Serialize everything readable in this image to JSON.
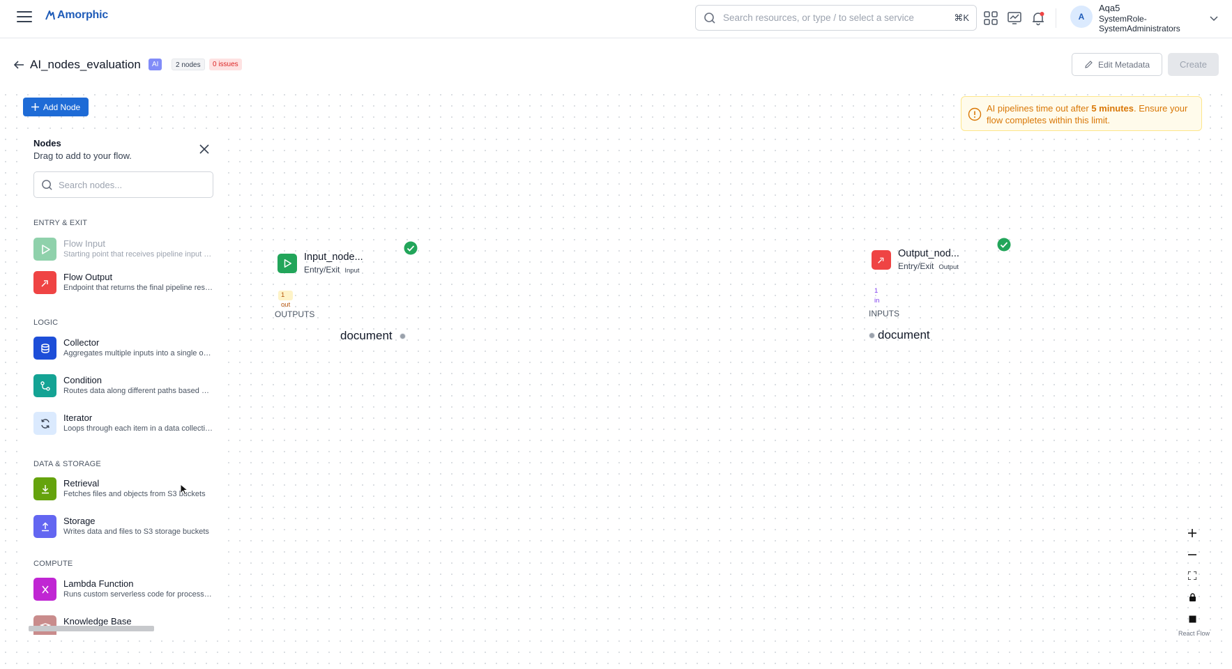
{
  "topbar": {
    "logo_text": "Amorphic",
    "search_placeholder": "Search resources, or type / to select a service",
    "search_shortcut": "⌘K",
    "avatar_initial": "A",
    "user_name": "Aqa5",
    "user_role": "SystemRole-SystemAdministrators"
  },
  "page": {
    "title": "AI_nodes_evaluation",
    "badge_ai": "AI",
    "badge_nodes": "2 nodes",
    "badge_issues": "0 issues",
    "edit_metadata_label": "Edit Metadata",
    "create_label": "Create"
  },
  "toolbar": {
    "add_node_label": "Add Node"
  },
  "panel": {
    "title": "Nodes",
    "subtitle": "Drag to add to your flow.",
    "search_placeholder": "Search nodes...",
    "categories": [
      {
        "label": "ENTRY & EXIT"
      },
      {
        "label": "LOGIC"
      },
      {
        "label": "DATA & STORAGE"
      },
      {
        "label": "COMPUTE"
      }
    ],
    "items": [
      {
        "title": "Flow Input",
        "desc": "Starting point that receives pipeline input data"
      },
      {
        "title": "Flow Output",
        "desc": "Endpoint that returns the final pipeline results"
      },
      {
        "title": "Collector",
        "desc": "Aggregates multiple inputs into a single output"
      },
      {
        "title": "Condition",
        "desc": "Routes data along different paths based on rules"
      },
      {
        "title": "Iterator",
        "desc": "Loops through each item in a data collection"
      },
      {
        "title": "Retrieval",
        "desc": "Fetches files and objects from S3 buckets"
      },
      {
        "title": "Storage",
        "desc": "Writes data and files to S3 storage buckets"
      },
      {
        "title": "Lambda Function",
        "desc": "Runs custom serverless code for processing"
      },
      {
        "title": "Knowledge Base",
        "desc": ""
      }
    ]
  },
  "warning": {
    "text_before": "AI pipelines time out after ",
    "text_bold": "5 minutes",
    "text_after": ". Ensure your flow completes within this limit."
  },
  "nodes": {
    "input": {
      "name": "Input_node...",
      "category": "Entry/Exit",
      "tag": "Input",
      "count": "1 out",
      "section": "OUTPUTS",
      "port": "document"
    },
    "output": {
      "name": "Output_nod...",
      "category": "Entry/Exit",
      "tag": "Output",
      "count": "1 in",
      "section": "INPUTS",
      "port": "document"
    }
  },
  "canvas": {
    "attribution": "React Flow"
  },
  "colors": {
    "primary": "#1e6bd6",
    "flow_input": "#22a55a",
    "flow_output": "#ef4444",
    "collector": "#1d4ed8",
    "condition": "#14a394",
    "iterator_bg": "#dbeafe",
    "retrieval": "#65a30d",
    "storage": "#6366f1",
    "lambda": "#c026d3",
    "knowledge_base": "#c98c8c",
    "warning": "#d97706"
  }
}
